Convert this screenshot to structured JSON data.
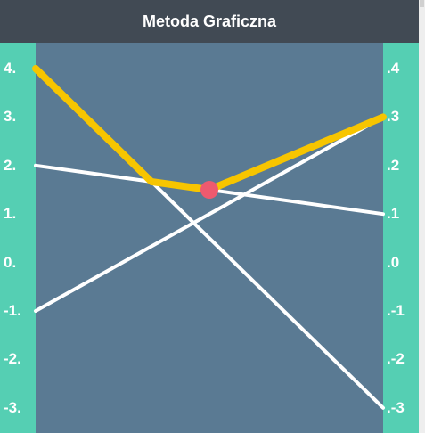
{
  "window": {
    "title": "Metoda Graficzna"
  },
  "left_axis": {
    "ticks": [
      "4.",
      "3.",
      "2.",
      "1.",
      "0.",
      "-1.",
      "-2.",
      "-3."
    ]
  },
  "right_axis": {
    "ticks": [
      ".4",
      ".3",
      ".2",
      ".1",
      ".0",
      ".-1",
      ".-2",
      ".-3"
    ]
  },
  "colors": {
    "background": "#5a7a93",
    "header": "#414a54",
    "axis_panel": "#55cfb3",
    "line": "#ffffff",
    "highlight": "#f7c500",
    "point": "#ee5a6f"
  },
  "chart_data": {
    "type": "line",
    "x": [
      0,
      1
    ],
    "ylim": [
      -3,
      4
    ],
    "series": [
      {
        "values": [
          2.0,
          1.0
        ]
      },
      {
        "values": [
          -1.0,
          3.0
        ]
      },
      {
        "values": [
          4.0,
          -3.0
        ]
      }
    ],
    "highlight_path": [
      [
        0,
        4.0
      ],
      [
        0.3333,
        1.6667
      ],
      [
        0.5,
        1.5
      ],
      [
        1,
        3.0
      ]
    ],
    "intersection_point": [
      0.5,
      1.5
    ]
  }
}
